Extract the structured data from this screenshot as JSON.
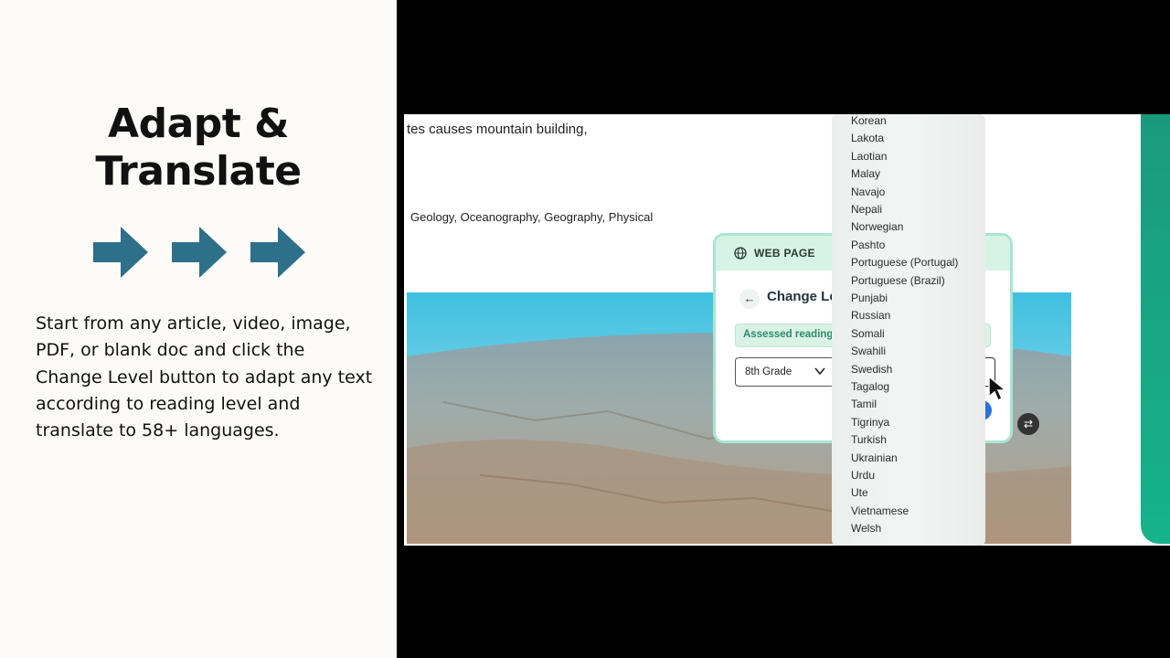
{
  "promo": {
    "headline_line1": "Adapt &",
    "headline_line2": "Translate",
    "description": "Start from any article, video, image, PDF, or blank doc and click the Change Level button to adapt any text according to reading level and translate to 58+ languages.",
    "arrow_color": "#2e6f8a"
  },
  "page": {
    "text_line_1": "tes causes mountain building,",
    "text_line_2": "Geology, Oceanography, Geography, Physical"
  },
  "modal": {
    "header_label": "WEB PAGE",
    "title": "Change Le",
    "assessed_label": "Assessed reading",
    "grade_value": "8th Grade",
    "accent_color": "#a8e6cf"
  },
  "languages": [
    "Korean",
    "Lakota",
    "Laotian",
    "Malay",
    "Navajo",
    "Nepali",
    "Norwegian",
    "Pashto",
    "Portuguese (Portugal)",
    "Portuguese (Brazil)",
    "Punjabi",
    "Russian",
    "Somali",
    "Swahili",
    "Swedish",
    "Tagalog",
    "Tamil",
    "Tigrinya",
    "Turkish",
    "Ukrainian",
    "Urdu",
    "Ute",
    "Vietnamese",
    "Welsh"
  ],
  "icons": {
    "globe": "globe-icon",
    "back": "arrow-left-icon",
    "chevron": "chevron-down-icon",
    "cursor": "mouse-pointer-icon",
    "float": "swap-icon"
  }
}
